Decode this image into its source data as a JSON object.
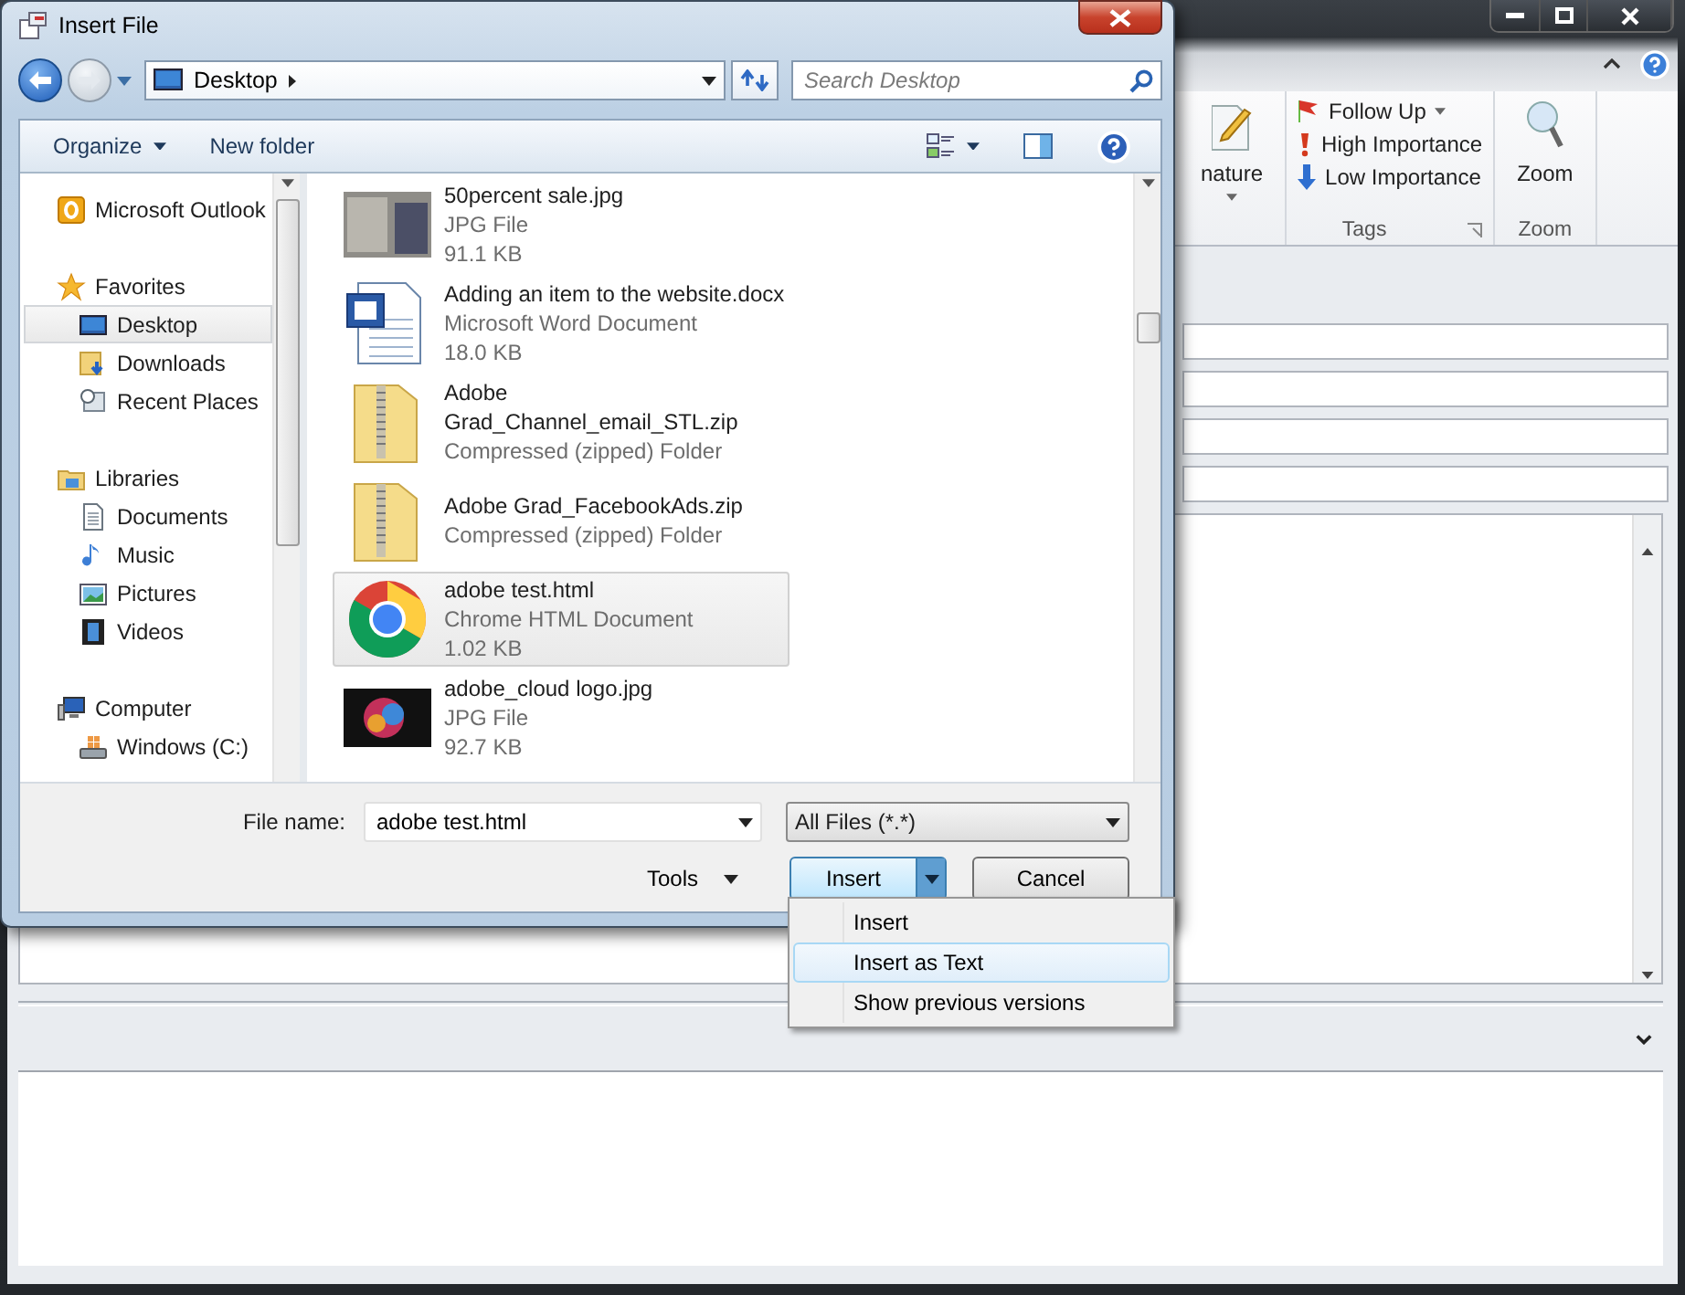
{
  "outlook": {
    "ribbon": {
      "signature_label": "nature",
      "tags": [
        {
          "kind": "flag",
          "label": "Follow Up",
          "dropdown": true
        },
        {
          "kind": "high",
          "label": "High Importance",
          "dropdown": false
        },
        {
          "kind": "low",
          "label": "Low Importance",
          "dropdown": false
        }
      ],
      "tags_group": "Tags",
      "zoom_button": "Zoom",
      "zoom_group": "Zoom"
    }
  },
  "dialog": {
    "title": "Insert File",
    "address": "Desktop",
    "search": {
      "placeholder": "Search Desktop"
    },
    "toolbar": {
      "organize": "Organize",
      "new_folder": "New folder"
    },
    "nav": [
      {
        "kind": "outlook",
        "label": "Microsoft Outlook",
        "selected": false
      },
      {
        "kind": "star",
        "label": "Favorites",
        "selected": false,
        "children": [
          {
            "kind": "desktop",
            "label": "Desktop",
            "selected": true
          },
          {
            "kind": "downloads",
            "label": "Downloads",
            "selected": false
          },
          {
            "kind": "recent",
            "label": "Recent Places",
            "selected": false
          }
        ]
      },
      {
        "kind": "library",
        "label": "Libraries",
        "selected": false,
        "children": [
          {
            "kind": "document",
            "label": "Documents",
            "selected": false
          },
          {
            "kind": "music",
            "label": "Music",
            "selected": false
          },
          {
            "kind": "picture",
            "label": "Pictures",
            "selected": false
          },
          {
            "kind": "video",
            "label": "Videos",
            "selected": false
          }
        ]
      },
      {
        "kind": "computer",
        "label": "Computer",
        "selected": false,
        "children": [
          {
            "kind": "drive",
            "label": "Windows (C:)",
            "selected": false
          }
        ]
      }
    ],
    "files": [
      {
        "kind": "photo",
        "name": "50percent sale.jpg",
        "type": "JPG File",
        "size": "91.1 KB",
        "selected": false
      },
      {
        "kind": "word",
        "name": "Adding an item to the website.docx",
        "type": "Microsoft Word Document",
        "size": "18.0 KB",
        "selected": false
      },
      {
        "kind": "zip",
        "name": "Adobe\nGrad_Channel_email_STL.zip",
        "type": "Compressed (zipped) Folder",
        "selected": false
      },
      {
        "kind": "zip",
        "name": "Adobe Grad_FacebookAds.zip",
        "type": "Compressed (zipped) Folder",
        "selected": false
      },
      {
        "kind": "chrome",
        "name": "adobe test.html",
        "type": "Chrome HTML Document",
        "size": "1.02 KB",
        "selected": true
      },
      {
        "kind": "artwork",
        "name": "adobe_cloud logo.jpg",
        "type": "JPG File",
        "size": "92.7 KB",
        "selected": false
      }
    ],
    "file_name_label": "File name:",
    "file_name": "adobe test.html",
    "filter": "All Files (*.*)",
    "tools": "Tools",
    "insert": "Insert",
    "cancel": "Cancel",
    "menu": [
      {
        "label": "Insert",
        "selected": false
      },
      {
        "label": "Insert as Text",
        "selected": true
      },
      {
        "label": "Show previous versions",
        "selected": false
      }
    ]
  }
}
